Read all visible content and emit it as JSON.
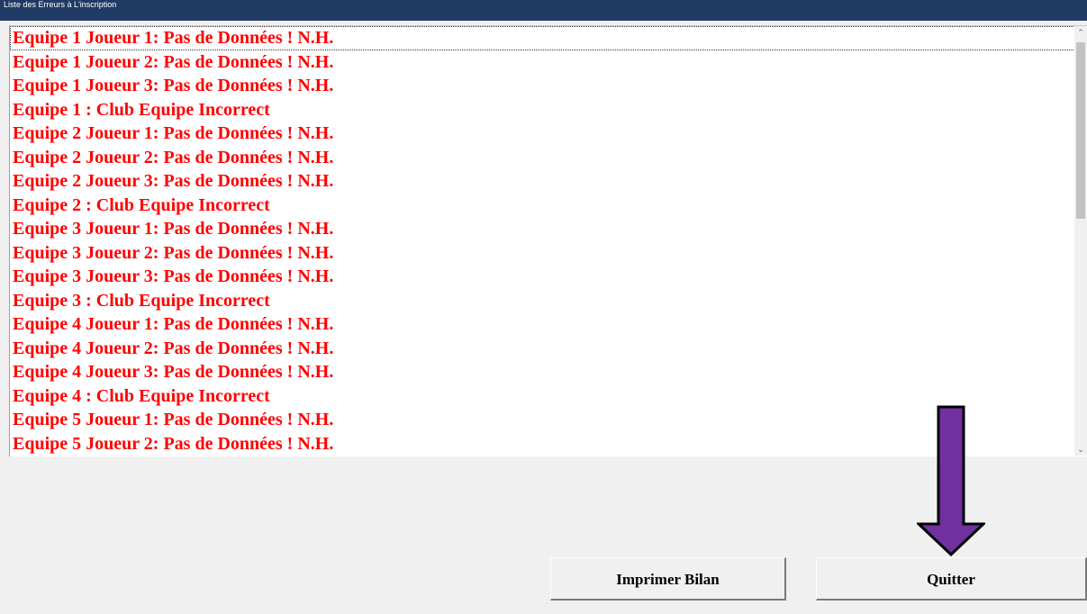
{
  "window": {
    "title": "Liste des Erreurs à L'inscription"
  },
  "errors": {
    "items": [
      "Equipe 1 Joueur 1: Pas de Données ! N.H.",
      "Equipe 1 Joueur 2: Pas de Données ! N.H.",
      "Equipe 1 Joueur 3: Pas de Données ! N.H.",
      "Equipe 1 : Club Equipe Incorrect",
      "Equipe 2 Joueur 1: Pas de Données ! N.H.",
      "Equipe 2 Joueur 2: Pas de Données ! N.H.",
      "Equipe 2 Joueur 3: Pas de Données ! N.H.",
      "Equipe 2 : Club Equipe Incorrect",
      "Equipe 3 Joueur 1: Pas de Données ! N.H.",
      "Equipe 3 Joueur 2: Pas de Données ! N.H.",
      "Equipe 3 Joueur 3: Pas de Données ! N.H.",
      "Equipe 3 : Club Equipe Incorrect",
      "Equipe 4 Joueur 1: Pas de Données ! N.H.",
      "Equipe 4 Joueur 2: Pas de Données ! N.H.",
      "Equipe 4 Joueur 3: Pas de Données ! N.H.",
      "Equipe 4 : Club Equipe Incorrect",
      "Equipe 5 Joueur 1: Pas de Données ! N.H.",
      "Equipe 5 Joueur 2: Pas de Données ! N.H."
    ],
    "text_color": "#ff0000"
  },
  "buttons": {
    "print_label": "Imprimer Bilan",
    "quit_label": "Quitter"
  },
  "icons": {
    "scroll_up": "chevron-up-icon",
    "scroll_down": "chevron-down-icon",
    "annotation": "down-arrow-annotation-icon"
  },
  "colors": {
    "titlebar": "#1f3b63",
    "annotation_arrow": "#7030a0"
  }
}
